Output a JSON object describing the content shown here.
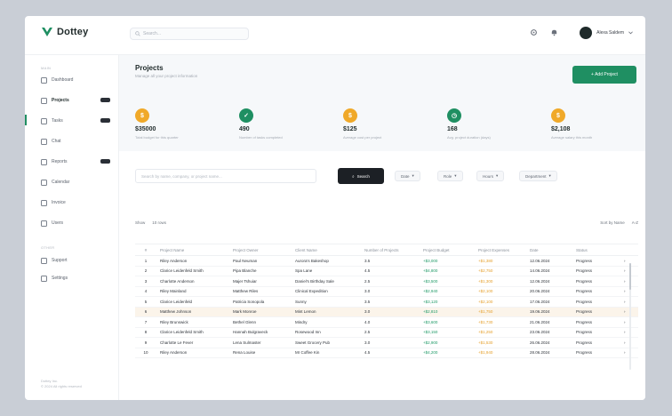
{
  "app": {
    "name": "Dottey",
    "search_placeholder": "Search...",
    "user_name": "Alexa Saldem"
  },
  "sidebar": {
    "section_main": "MAIN",
    "items": [
      {
        "label": "Dashboard",
        "icon": "dashboard-icon"
      },
      {
        "label": "Projects",
        "icon": "projects-icon"
      },
      {
        "label": "Tasks",
        "icon": "tasks-icon"
      },
      {
        "label": "Chat",
        "icon": "chat-icon"
      },
      {
        "label": "Reports",
        "icon": "reports-icon"
      },
      {
        "label": "Calendar",
        "icon": "calendar-icon"
      },
      {
        "label": "Invoice",
        "icon": "invoice-icon"
      },
      {
        "label": "Users",
        "icon": "users-icon"
      }
    ],
    "section_other": "OTHER",
    "other_items": [
      {
        "label": "Support",
        "icon": "support-icon"
      },
      {
        "label": "Settings",
        "icon": "settings-icon"
      }
    ],
    "footer_line1": "Dottey Inc.",
    "footer_line2": "© 2024 All rights reserved"
  },
  "header": {
    "title": "Projects",
    "subtitle": "Manage all your project information",
    "add_button": "+ Add Project"
  },
  "stats": [
    {
      "value": "$35000",
      "label": "Total budget for this quarter",
      "color": "#f0a929"
    },
    {
      "value": "490",
      "label": "Number of tasks completed",
      "color": "#1f8f62"
    },
    {
      "value": "$125",
      "label": "Average cost per project",
      "color": "#f0a929"
    },
    {
      "value": "168",
      "label": "Avg. project duration (days)",
      "color": "#1f8f62"
    },
    {
      "value": "$2,108",
      "label": "Average salary this month",
      "color": "#f0a929"
    }
  ],
  "filters": {
    "search_placeholder": "Search by name, company, or project name...",
    "search_button": "Search",
    "chips": [
      "Date",
      "Role",
      "Hours",
      "Department"
    ]
  },
  "list_controls": {
    "show_label": "Show",
    "entries_label": "10 rows",
    "sort_label": "Sort by Name",
    "sort_value": "A-Z"
  },
  "table": {
    "headers": [
      "#",
      "Project Name",
      "Project Owner",
      "Client Name",
      "Number of Projects",
      "Project Budget",
      "Project Expenses",
      "Date",
      "Status"
    ],
    "rows": [
      [
        "1",
        "Riley Anderson",
        "Paul Neuman",
        "Aurora's Bakeshop",
        "3.5",
        "+$3,000",
        "+$1,380",
        "12.06.2024",
        "Progress"
      ],
      [
        "2",
        "Clarice Leidenfeld Smith",
        "Pipa Blanche",
        "Spa Lane",
        "4.5",
        "+$4,800",
        "+$2,750",
        "14.06.2024",
        "Progress"
      ],
      [
        "3",
        "Charlotte Anderson",
        "Majer Tshuiar",
        "Daniel's Birthday Sale",
        "2.5",
        "+$3,500",
        "+$1,300",
        "12.06.2024",
        "Progress"
      ],
      [
        "4",
        "Riley Mainland",
        "Matthew Riles",
        "Clinical Expedition",
        "3.0",
        "+$2,940",
        "+$2,100",
        "20.06.2024",
        "Progress"
      ],
      [
        "5",
        "Clarice Leidenfeld",
        "Patricia Sonopola",
        "Sunny",
        "3.5",
        "+$3,120",
        "+$2,100",
        "17.06.2024",
        "Progress"
      ],
      [
        "6",
        "Matthew Johnson",
        "Mark Monroe",
        "Mint Lemon",
        "3.0",
        "+$2,810",
        "+$1,750",
        "19.06.2024",
        "Progress"
      ],
      [
        "7",
        "Riley Brunswick",
        "Bethel Glenn",
        "Mindry",
        "4.0",
        "+$3,600",
        "+$1,730",
        "21.06.2024",
        "Progress"
      ],
      [
        "8",
        "Clarice Leidenfeld Smith",
        "Hannah Bulgraveck",
        "Rosewood Inn",
        "2.5",
        "+$3,150",
        "+$1,250",
        "23.06.2024",
        "Progress"
      ],
      [
        "9",
        "Charlotte Le Fever",
        "Lena Sulmaster",
        "Sweet Grocery Pub",
        "3.0",
        "+$2,900",
        "+$1,530",
        "26.06.2024",
        "Progress"
      ],
      [
        "10",
        "Riley Anderson",
        "Rena Louise",
        "Mr Coffee Kin",
        "4.5",
        "+$4,200",
        "+$1,940",
        "28.06.2024",
        "Progress"
      ]
    ],
    "highlight_row": 5
  },
  "colors": {
    "accent": "#1f8f62",
    "amber": "#f0a929",
    "dark": "#1c2025"
  }
}
